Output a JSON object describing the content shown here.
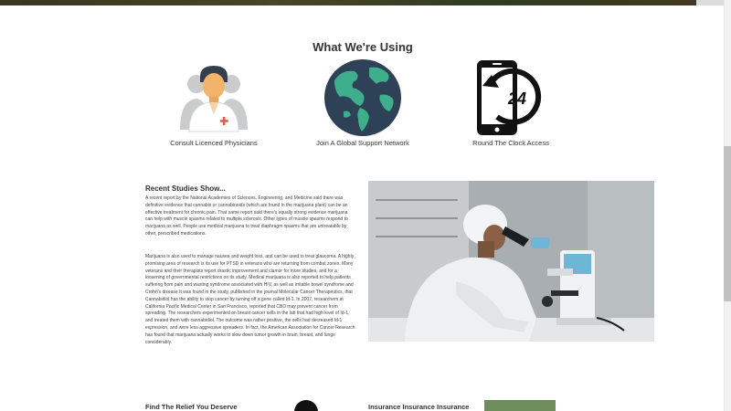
{
  "section": {
    "title": "What We're Using"
  },
  "features": [
    {
      "label": "Consult Licenced Physicians",
      "icon": "physician-icon"
    },
    {
      "label": "Join A Global Support Network",
      "icon": "globe-icon"
    },
    {
      "label": "Round The Clock Access",
      "icon": "24-hour-phone-icon",
      "badge": "24"
    }
  ],
  "studies": {
    "heading": "Recent Studies Show...",
    "paragraphs": [
      "A recent report by the National Academies of Sciences, Engineering, and Medicine said there was definitive evidence that cannabis or cannabinoids (which are found in the marijuana plant) can be an effective treatment for chronic pain. That same report said there's equally strong evidence marijuana can help with muscle spasms related to multiple sclerosis. Other types of muscle spasms respond to marijuana as well. People use medical marijuana to treat diaphragm spasms that are untreatable by other, prescribed medications.",
      "Marijuana is also used to manage nausea and weight loss, and can be used to treat glaucoma. A highly promising area of research is its use for PTSD in veterans who are returning from combat zones. Many veterans and their therapists report drastic improvement and clamor for more studies, and for a loosening of governmental restrictions on its study. Medical marijuana is also reported to help patients suffering from pain and wasting syndrome associated with HIV, as well as irritable bowel syndrome and Crohn's disease.It was found in the study, published in the journal Molecular Cancer Therapeutics, that Cannabidiol has the ability to stop cancer by turning off a gene called Id-1. In 2007, researchers at California Pacific Medical Center in San Francisco, reported that CBD may prevent cancer from spreading. The researchers experimented on breast cancer cells in the lab that had high level of Id-1, and treated them with cannabidiol. The outcome was rather positive, the cells had decreased Id-1 expression, and were less aggressive spreaders. In fact, the American Association for Cancer Research has found that marijuana actually works to slow down tumor growth in brain, breast, and lungs considerably."
    ]
  },
  "bottom": {
    "left_heading": "Find The Relief You Deserve",
    "right_heading": "Insurance Insurance Insurance"
  },
  "colors": {
    "physician_skin": "#f2b36b",
    "physician_coat": "#ffffff",
    "ocean": "#2f4156",
    "land": "#3fae8c",
    "phone_black": "#111111"
  }
}
